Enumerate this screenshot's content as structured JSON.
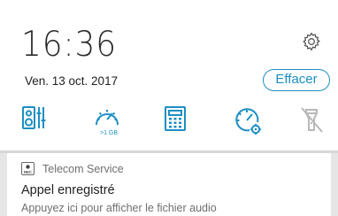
{
  "status": {
    "time": "16:36",
    "date": "Ven. 13 oct. 2017"
  },
  "actions": {
    "clear_label": "Effacer"
  },
  "quick_settings": {
    "mobile_manager_caption": ">1 GB"
  },
  "notification": {
    "app_name": "Telecom Service",
    "rec_label": "REC",
    "title": "Appel enregistré",
    "text": "Appuyez ici pour afficher le fichier audio"
  },
  "colors": {
    "accent": "#1d8fc3",
    "disabled": "#b8b8b8"
  }
}
